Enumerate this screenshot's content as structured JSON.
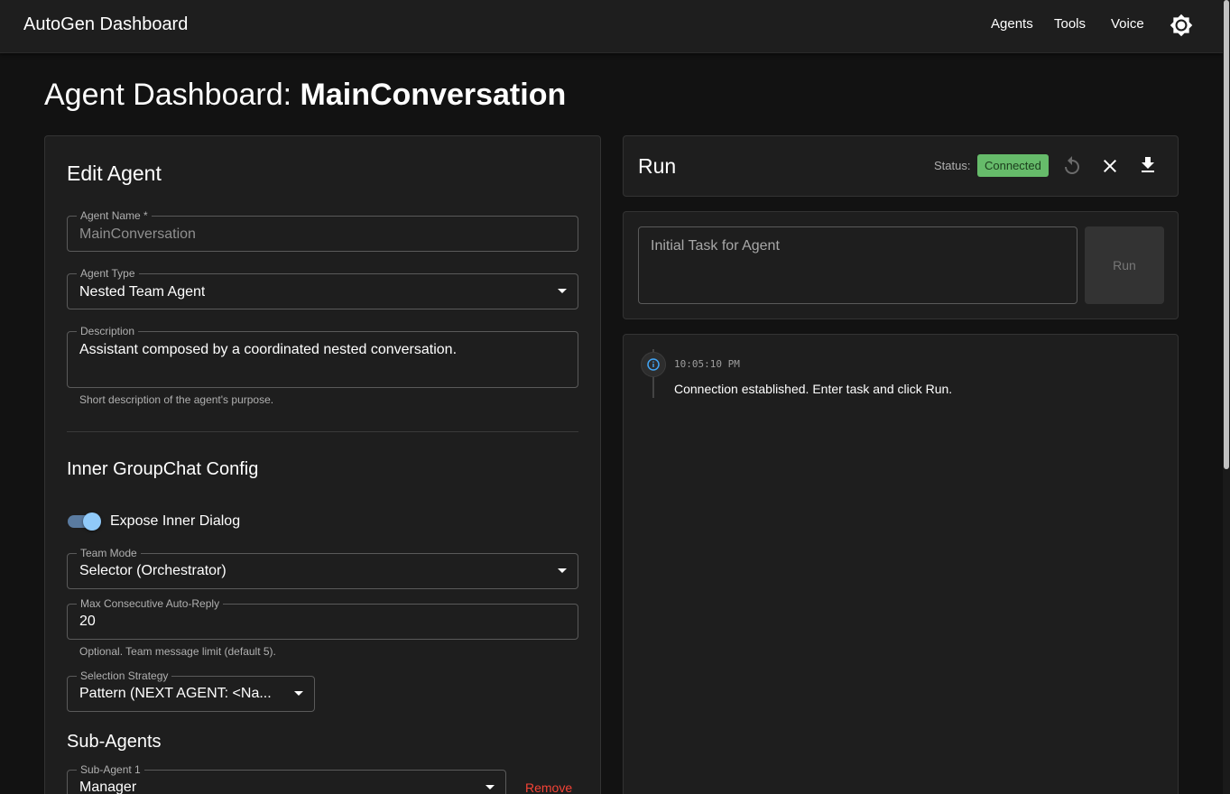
{
  "app": {
    "title": "AutoGen Dashboard",
    "nav": [
      "Agents",
      "Tools",
      "Voice"
    ],
    "theme_icon": "brightness-icon"
  },
  "page": {
    "title_prefix": "Agent Dashboard: ",
    "title_name": "MainConversation"
  },
  "edit": {
    "heading": "Edit Agent",
    "agent_name": {
      "label": "Agent Name *",
      "value": "MainConversation"
    },
    "agent_type": {
      "label": "Agent Type",
      "value": "Nested Team Agent"
    },
    "description": {
      "label": "Description",
      "value": "Assistant composed by a coordinated nested conversation.",
      "helper": "Short description of the agent's purpose."
    },
    "inner_heading": "Inner GroupChat Config",
    "expose_inner": {
      "label": "Expose Inner Dialog",
      "checked": true
    },
    "team_mode": {
      "label": "Team Mode",
      "value": "Selector (Orchestrator)"
    },
    "max_reply": {
      "label": "Max Consecutive Auto-Reply",
      "value": "20",
      "helper": "Optional. Team message limit (default 5)."
    },
    "selection_strategy": {
      "label": "Selection Strategy",
      "value": "Pattern (NEXT AGENT: <Na..."
    },
    "sub_agents_heading": "Sub-Agents",
    "sub_agent_1": {
      "label": "Sub-Agent 1",
      "value": "Manager",
      "remove": "Remove"
    }
  },
  "run": {
    "heading": "Run",
    "status_label": "Status:",
    "status_value": "Connected",
    "status_color": "#66bb6a",
    "icons": [
      "restart-icon",
      "close-icon",
      "download-icon"
    ],
    "task_placeholder": "Initial Task for Agent",
    "run_button": "Run"
  },
  "log": [
    {
      "time": "10:05:10 PM",
      "message": "Connection established. Enter task and click Run.",
      "icon": "info-icon"
    }
  ]
}
